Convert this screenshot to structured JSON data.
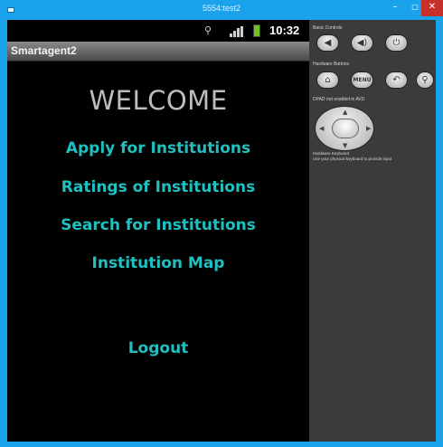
{
  "window": {
    "title": "5554:test2",
    "min_glyph": "–",
    "max_glyph": "□",
    "close_glyph": "✕"
  },
  "statusbar": {
    "usb_glyph": "⚲",
    "time": "10:32"
  },
  "app": {
    "title": "Smartagent2",
    "welcome": "WELCOME",
    "links": [
      "Apply for Institutions",
      "Ratings of Institutions",
      "Search for Institutions",
      "Institution Map",
      "Logout"
    ]
  },
  "panel": {
    "basic_controls_label": "Basic Controls",
    "hardware_buttons_label": "Hardware Buttons",
    "dpad_label": "DPAD not enabled in AVD",
    "keyboard_label": "Hardware Keyboard",
    "keyboard_text": "Use your physical keyboard to provide input",
    "vol_down_glyph": "◀",
    "vol_up_glyph": "◀)",
    "power_glyph": "⏻",
    "home_glyph": "⌂",
    "menu_label": "MENU",
    "back_glyph": "↶",
    "search_glyph": "⚲"
  },
  "colors": {
    "link": "#21c0c0",
    "welcome": "#bdbdbd",
    "titlebar": "#1aa3ec",
    "panel": "#3b3b3b"
  }
}
